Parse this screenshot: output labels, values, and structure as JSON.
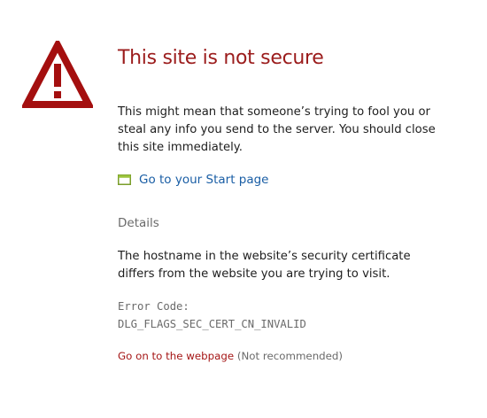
{
  "icon": "warning-triangle-icon",
  "colors": {
    "title": "#9b1c1c",
    "warning_icon": "#a40f0f",
    "link": "#1a5ea5",
    "proceed_link": "#a51616",
    "muted": "#6a6a6a"
  },
  "title": "This site is not secure",
  "message": "This might mean that someone’s trying to fool you or steal any info you send to the server. You should close this site immediately.",
  "start_link": {
    "icon": "page-icon",
    "label": "Go to your Start page"
  },
  "details": {
    "heading": "Details",
    "text": "The hostname in the website’s security certificate differs from the website you are trying to visit.",
    "error_code_label": "Error Code:",
    "error_code": "DLG_FLAGS_SEC_CERT_CN_INVALID"
  },
  "proceed": {
    "link_label": "Go on to the webpage",
    "note": "(Not recommended)"
  }
}
